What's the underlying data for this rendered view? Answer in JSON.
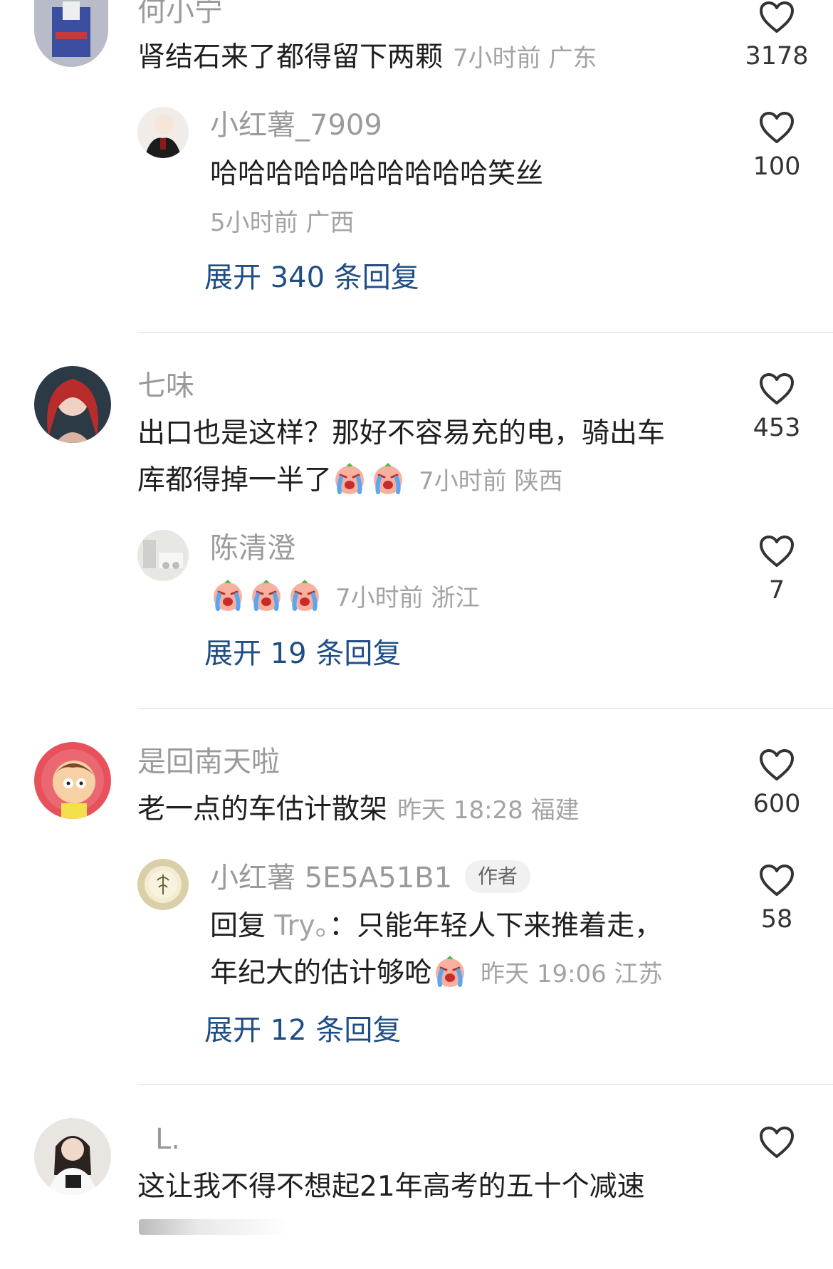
{
  "colors": {
    "name": "#9a9a9a",
    "text": "#1f1f1f",
    "meta": "#a3a3a3",
    "expand": "#1f4e86",
    "divider": "#ececec"
  },
  "comments": [
    {
      "name": "何小宁",
      "text": "肾结石来了都得留下两颗",
      "meta": "7小时前 广东",
      "likes": "3178",
      "reply": {
        "name": "小红薯_7909",
        "text": "哈哈哈哈哈哈哈哈哈哈笑丝",
        "meta": "5小时前 广西",
        "likes": "100"
      },
      "expand": "展开 340 条回复"
    },
    {
      "name": "七味",
      "text_line1": "出口也是这样？那好不容易充的电，骑出车",
      "text_line2": "库都得掉一半了",
      "meta": "7小时前 陕西",
      "likes": "453",
      "reply": {
        "name": "陈清澄",
        "meta": "7小时前 浙江",
        "likes": "7"
      },
      "expand": "展开 19 条回复"
    },
    {
      "name": "是回南天啦",
      "text": "老一点的车估计散架",
      "meta": "昨天 18:28 福建",
      "likes": "600",
      "reply": {
        "name": "小红薯 5E5A51B1",
        "badge": "作者",
        "text_prefix": "回复 ",
        "reply_to": "Try。",
        "text_line1": "：只能年轻人下来推着走，",
        "text_line2": "年纪大的估计够呛",
        "meta": "昨天 19:06 江苏",
        "likes": "58"
      },
      "expand": "展开 12 条回复"
    },
    {
      "name": "L.",
      "text": "这让我不得不想起21年高考的五十个减速",
      "likes": ""
    }
  ],
  "icons": {
    "like": "heart-outline-icon",
    "emoji": "crying-face-emoji"
  }
}
